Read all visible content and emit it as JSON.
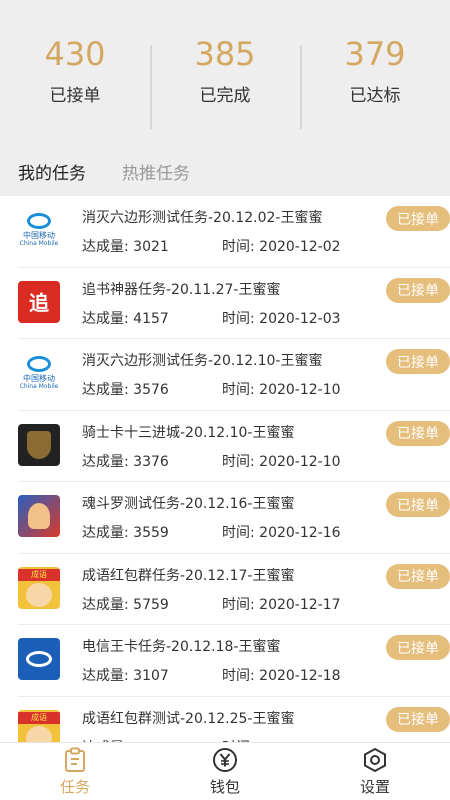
{
  "stats": [
    {
      "value": "430",
      "label": "已接单"
    },
    {
      "value": "385",
      "label": "已完成"
    },
    {
      "value": "379",
      "label": "已达标"
    }
  ],
  "tabs": {
    "my": "我的任务",
    "hot": "热推任务"
  },
  "meta_labels": {
    "count": "达成量:",
    "time": "时间:"
  },
  "tasks": [
    {
      "icon": "china-mobile-icon",
      "title": "消灭六边形测试任务-20.12.02-王蜜蜜",
      "count": "3021",
      "time": "2020-12-02",
      "status": "已接单"
    },
    {
      "icon": "zhuishu-icon",
      "title": "追书神器任务-20.11.27-王蜜蜜",
      "count": "4157",
      "time": "2020-12-03",
      "status": "已接单"
    },
    {
      "icon": "china-mobile-icon",
      "title": "消灭六边形测试任务-20.12.10-王蜜蜜",
      "count": "3576",
      "time": "2020-12-10",
      "status": "已接单"
    },
    {
      "icon": "knight-game-icon",
      "title": "骑士卡十三进城-20.12.10-王蜜蜜",
      "count": "3376",
      "time": "2020-12-10",
      "status": "已接单"
    },
    {
      "icon": "contra-game-icon",
      "title": "魂斗罗测试任务-20.12.16-王蜜蜜",
      "count": "3559",
      "time": "2020-12-16",
      "status": "已接单"
    },
    {
      "icon": "chengyu-game-icon",
      "title": "成语红包群任务-20.12.17-王蜜蜜",
      "count": "5759",
      "time": "2020-12-17",
      "status": "已接单"
    },
    {
      "icon": "china-telecom-icon",
      "title": "电信王卡任务-20.12.18-王蜜蜜",
      "count": "3107",
      "time": "2020-12-18",
      "status": "已接单"
    },
    {
      "icon": "chengyu-game-icon",
      "title": "成语红包群测试-20.12.25-王蜜蜜",
      "count": "",
      "time": "",
      "status": "已接单"
    }
  ],
  "icon_text": {
    "cm1": "中国移动",
    "cm2": "China Mobile",
    "zhui": "追",
    "cy": "成语"
  },
  "tabbar": [
    {
      "label": "任务",
      "icon": "task-clipboard-icon",
      "active": true
    },
    {
      "label": "钱包",
      "icon": "wallet-yen-icon",
      "active": false
    },
    {
      "label": "设置",
      "icon": "settings-hex-icon",
      "active": false
    }
  ],
  "colors": {
    "accent": "#d5a862",
    "badge": "#e6be7b"
  }
}
